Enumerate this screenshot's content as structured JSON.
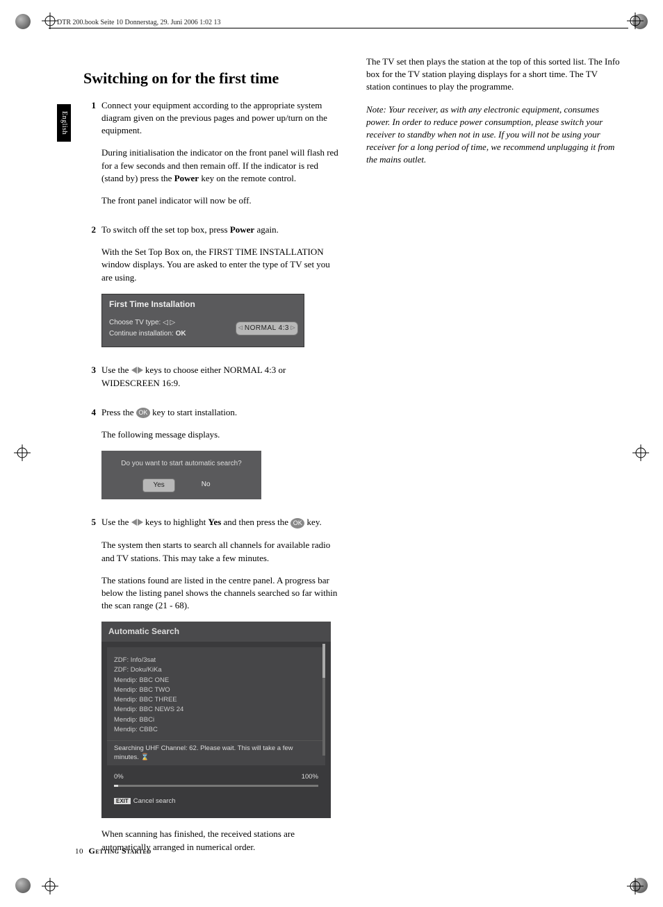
{
  "meta": {
    "header": "DTR 200.book  Seite 10  Donnerstag, 29. Juni 2006  1:02 13"
  },
  "lang_tab": "English",
  "heading": "Switching on for the first time",
  "steps": {
    "s1": {
      "num": "1",
      "p1": "Connect your equipment according to the appropriate system diagram given on the previous pages and power up/turn on the equipment.",
      "p2a": "During initialisation the indicator on the front panel will flash red for a few seconds and then remain off. If the indicator is red (stand by) press the ",
      "p2b": "Power",
      "p2c": " key on the remote control.",
      "p3": "The front panel indicator will now be off."
    },
    "s2": {
      "num": "2",
      "p1a": "To switch off the set top box, press ",
      "p1b": "Power",
      "p1c": " again.",
      "p2": "With the Set Top Box on, the FIRST TIME INSTALLATION window displays. You are asked to enter the type of TV set you are using."
    },
    "s3": {
      "num": "3",
      "p1a": "Use the ",
      "p1b": " keys to choose either NORMAL 4:3 or WIDESCREEN 16:9."
    },
    "s4": {
      "num": "4",
      "p1a": "Press the ",
      "p1b": " key to start installation.",
      "p2": "The following message displays."
    },
    "s5": {
      "num": "5",
      "p1a": "Use the ",
      "p1b": " keys to highlight ",
      "p1c": "Yes",
      "p1d": " and then press the ",
      "p1e": " key.",
      "p2": "The system then starts to search all channels for available radio and TV stations. This may take a few minutes.",
      "p3": "The stations found are listed in the centre panel. A progress bar below the listing panel  shows the channels searched  so far within the scan range (21 - 68).",
      "p4": "When scanning has finished, the received stations are automatically arranged in numerical order."
    }
  },
  "ui1": {
    "title": "First Time Installation",
    "line1": "Choose TV type: ◁ ▷",
    "line2a": "Continue installation:  ",
    "line2b": "OK",
    "option": "NORMAL 4:3"
  },
  "ui2": {
    "question": "Do you want to start automatic search?",
    "yes": "Yes",
    "no": "No"
  },
  "ui3": {
    "title": "Automatic Search",
    "items": [
      "ZDF: Info/3sat",
      "ZDF: Doku/KiKa",
      "Mendip: BBC ONE",
      "Mendip: BBC TWO",
      "Mendip: BBC THREE",
      "Mendip: BBC NEWS 24",
      "Mendip: BBCi",
      "Mendip: CBBC"
    ],
    "status": "Searching UHF Channel: 62. Please wait. This will take a few minutes.",
    "p0": "0%",
    "p100": "100%",
    "exit": "EXIT",
    "cancel": "Cancel search"
  },
  "ok_label": "OK",
  "col2": {
    "p1": "The TV set then plays the station at the top of this sorted list. The Info box for the TV station playing displays for a short time. The TV station continues to play the programme.",
    "note_label": "Note:  ",
    "note": "Your receiver, as with any electronic equipment, consumes power. In order to reduce power consumption, please switch your receiver to standby when not in use. If you will not be using your receiver for a long period of time, we recommend unplugging it from the mains outlet."
  },
  "footer": {
    "page": "10",
    "section": "Getting Started"
  }
}
